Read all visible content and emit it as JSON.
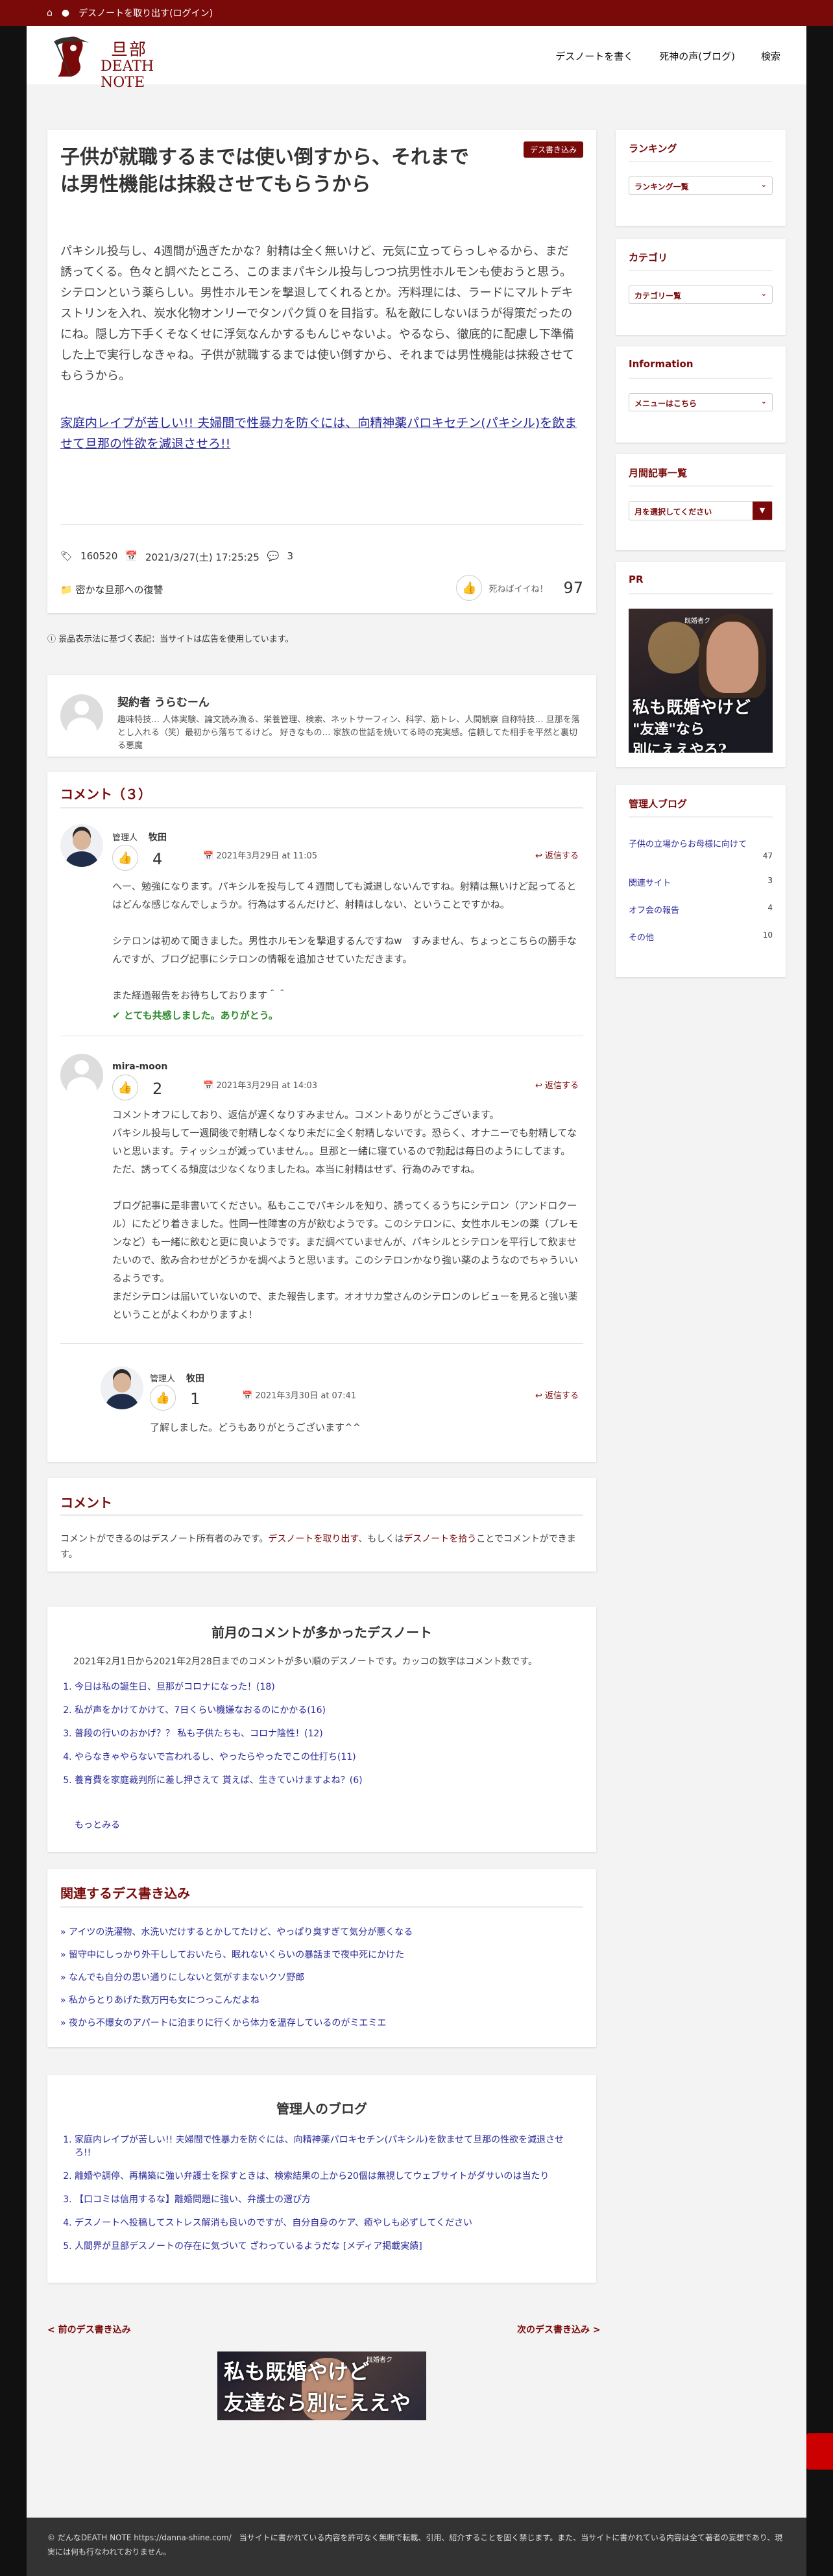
{
  "topbar": {
    "home_icon": "home-icon",
    "user_icon": "user-icon",
    "login_text": "デスノートを取り出す(ログイン)"
  },
  "header": {
    "logo_jp": "旦部",
    "logo_en": "DEATH NOTE",
    "nav": [
      "デスノートを書く",
      "死神の声(ブログ)",
      "検索"
    ]
  },
  "article": {
    "badge": "デス書き込み",
    "title": "子供が就職するまでは使い倒すから、それまでは男性機能は抹殺させてもらうから",
    "body": "パキシル投与し、4週間が過ぎたかな？射精は全く無いけど、元気に立ってらっしゃるから、まだ誘ってくる。色々と調べたところ、このままパキシル投与しつつ抗男性ホルモンも使おうと思う。シテロンという薬らしい。男性ホルモンを撃退してくれるとか。汚料理には、ラードにマルトデキストリンを入れ、炭水化物オンリーでタンパク質０を目指す。私を敵にしないほうが得策だったのにね。隠し方下手くそなくせに浮気なんかするもんじゃないよ。やるなら、徹底的に配慮し下準備した上で実行しなきゃね。子供が就職するまでは使い倒すから、それまでは男性機能は抹殺させてもらうから。",
    "link": "家庭内レイプが苦しい!! 夫婦間で性暴力を防ぐには、向精神薬パロキセチン(パキシル)を飲ませて旦那の性欲を減退させろ!!",
    "tag": "160520",
    "date": "2021/3/27(土) 17:25:25",
    "comment_count": "3",
    "category": "密かな旦那への復讐",
    "like_label": "死ねばイイね！",
    "like_count": "97"
  },
  "notice": "景品表示法に基づく表記：当サイトは広告を使用しています。",
  "author": {
    "name": "契約者 うらむーん",
    "desc": "趣味特技… 人体実験、論文読み漁る、栄養管理、検索、ネットサーフィン、科学、筋トレ、人間観察 自称特技… 旦那を落とし入れる（笑）最初から落ちてるけど。 好きなもの… 家族の世話を焼いてる時の充実感。信頼してた相手を平然と裏切る悪魔"
  },
  "comments": {
    "title": "コメント（３）",
    "items": [
      {
        "role": "管理人",
        "name": "牧田",
        "count": "4",
        "date": "2021年3月29日 at 11:05",
        "reply": "返信する",
        "text1": "へー、勉強になります。パキシルを投与して４週間しても減退しないんですね。射精は無いけど起ってるとはどんな感じなんでしょうか。行為はするんだけど、射精はしない、ということですかね。",
        "text2": "シテロンは初めて聞きました。男性ホルモンを撃退するんですねw　すみません、ちょっとこちらの勝手なんですが、ブログ記事にシテロンの情報を追加させていただきます。",
        "text3": "また経過報告をお待ちしております＾＾",
        "thanks": "とても共感しました。ありがとう。"
      },
      {
        "name": "mira-moon",
        "count": "2",
        "date": "2021年3月29日 at 14:03",
        "reply": "返信する",
        "lines": [
          "コメントオフにしており、返信が遅くなりすみません。コメントありがとうございます。",
          "パキシル投与して一週間後で射精しなくなり未だに全く射精しないです。恐らく、オナニーでも射精してないと思います。ティッシュが減っていません。。旦那と一緒に寝ているので勃起は毎日のようにしてます。ただ、誘ってくる頻度は少なくなりましたね。本当に射精はせず、行為のみですね。",
          "ブログ記事に是非書いてください。私もここでパキシルを知り、誘ってくるうちにシテロン（アンドロクール）にたどり着きました。性同一性障害の方が飲むようです。このシテロンに、女性ホルモンの薬（プレモンなど）も一緒に飲むと更に良いようです。まだ調べていませんが、パキシルとシテロンを平行して飲ませたいので、飲み合わせがどうかを調べようと思います。このシテロンかなり強い薬のようなのでちゃういいるようです。",
          "まだシテロンは届いていないので、また報告します。オオサカ堂さんのシテロンのレビューを見ると強い薬ということがよくわかりますよ！"
        ]
      },
      {
        "role": "管理人",
        "name": "牧田",
        "count": "1",
        "date": "2021年3月30日 at 07:41",
        "reply": "返信する",
        "text": "了解しました。どうもありがとうございます^^"
      }
    ]
  },
  "login": {
    "title": "コメント",
    "pre": "コメントができるのはデスノート所有者のみです。",
    "link1": "デスノートを取り出す",
    "mid": "、もしくは",
    "link2": "デスノートを拾う",
    "post": "ことでコメントができます。"
  },
  "lastmonth": {
    "title": "前月のコメントが多かったデスノート",
    "sub": "2021年2月1日から2021年2月28日までのコメントが多い順のデスノートです。カッコの数字はコメント数です。",
    "items": [
      "今日は私の誕生日、旦那がコロナになった！(18)",
      "私が声をかけてかけて、7日くらい機嫌なおるのにかかる(16)",
      "普段の行いのおかげ？？ 私も子供たちも、コロナ陰性！(12)",
      "やらなきゃやらないで言われるし、やったらやったでこの仕打ち(11)",
      "養育費を家庭裁判所に差し押さえて 貰えば、生きていけますよね？(6)"
    ],
    "more": "もっとみる"
  },
  "related": {
    "title": "関連するデス書き込み",
    "items": [
      "アイツの洗濯物、水洗いだけするとかしてたけど、やっぱり臭すぎて気分が悪くなる",
      "留守中にしっかり外干ししておいたら、眠れないくらいの暴話まで夜中死にかけた",
      "なんでも自分の思い通りにしないと気がすまないクソ野郎",
      "私からとりあげた数万円も女につっこんだよね",
      "夜から不爆女のアパートに泊まりに行くから体力を温存しているのがミエミエ"
    ]
  },
  "adminblog": {
    "title": "管理人のブログ",
    "items": [
      "家庭内レイプが苦しい!! 夫婦間で性暴力を防ぐには、向精神薬パロキセチン(パキシル)を飲ませて旦那の性欲を減退させろ!!",
      "離婚や調停、再構築に強い弁護士を探すときは、検索結果の上から20個は無視してウェブサイトがダサいのは当たり",
      "【口コミは信用するな】離婚問題に強い、弁護士の選び方",
      "デスノートへ投稿してストレス解消も良いのですが、自分自身のケア、癒やしも必ずしてください",
      "人間界が旦部デスノートの存在に気づいて ざわっているようだな [メディア掲載実績]"
    ]
  },
  "pager": {
    "prev": "< 前のデス書き込み",
    "next": "次のデス書き込み >"
  },
  "banner": {
    "line1": "私も既婚やけど",
    "line2": "友達なら別にええやろ?",
    "tag": "既婚者ク"
  },
  "sidebar": {
    "ranking": {
      "title": "ランキング",
      "select": "ランキング一覧"
    },
    "category": {
      "title": "カテゴリ",
      "select": "カテゴリー覧"
    },
    "info": {
      "title": "Information",
      "select": "メニューはこちら"
    },
    "monthly": {
      "title": "月間記事一覧",
      "select": "月を選択してください"
    },
    "pr": {
      "title": "PR",
      "line1": "私も既婚やけど",
      "line2": "\"友達\"なら",
      "line3": "別にええやろ?",
      "tag": "既婚者ク"
    },
    "blog": {
      "title": "管理人ブログ",
      "items": [
        {
          "label": "子供の立場からお母様に向けて",
          "count": "47"
        },
        {
          "label": "関連サイト",
          "count": "3"
        },
        {
          "label": "オフ会の報告",
          "count": "4"
        },
        {
          "label": "その他",
          "count": "10"
        }
      ]
    }
  },
  "footer": {
    "text": "© だんなDEATH NOTE https://danna-shine.com/　当サイトに書かれている内容を許可なく無断で転載、引用、紹介することを固く禁じます。また、当サイトに書かれている内容は全て著者の妄想であり、現実には何も行なわれておりません。"
  }
}
